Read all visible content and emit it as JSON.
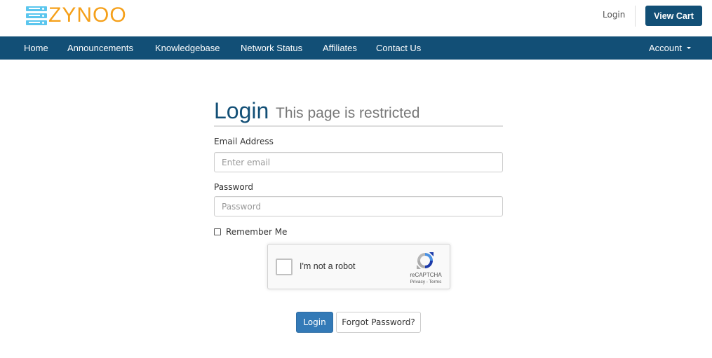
{
  "brand": {
    "name": "ZYNOO",
    "logo_icon": "server-stack-icon",
    "colors": {
      "text": "#f5a01a",
      "icon": "#5bc6ee"
    }
  },
  "topbar": {
    "login_label": "Login",
    "view_cart_label": "View Cart"
  },
  "nav": {
    "items": [
      {
        "label": "Home"
      },
      {
        "label": "Announcements"
      },
      {
        "label": "Knowledgebase"
      },
      {
        "label": "Network Status"
      },
      {
        "label": "Affiliates"
      },
      {
        "label": "Contact Us"
      }
    ],
    "account_label": "Account",
    "account_icon": "caret-down-icon",
    "background": "#124f76"
  },
  "login": {
    "title": "Login",
    "subtitle": "This page is restricted",
    "email": {
      "label": "Email Address",
      "placeholder": "Enter email",
      "value": ""
    },
    "password": {
      "label": "Password",
      "placeholder": "Password",
      "value": ""
    },
    "remember_label": "Remember Me",
    "remember_checked": false,
    "recaptcha": {
      "label": "I'm not a robot",
      "brand": "reCAPTCHA",
      "links": "Privacy - Terms",
      "checked": false
    },
    "submit_label": "Login",
    "forgot_label": "Forgot Password?",
    "accent": "#337ab7"
  }
}
